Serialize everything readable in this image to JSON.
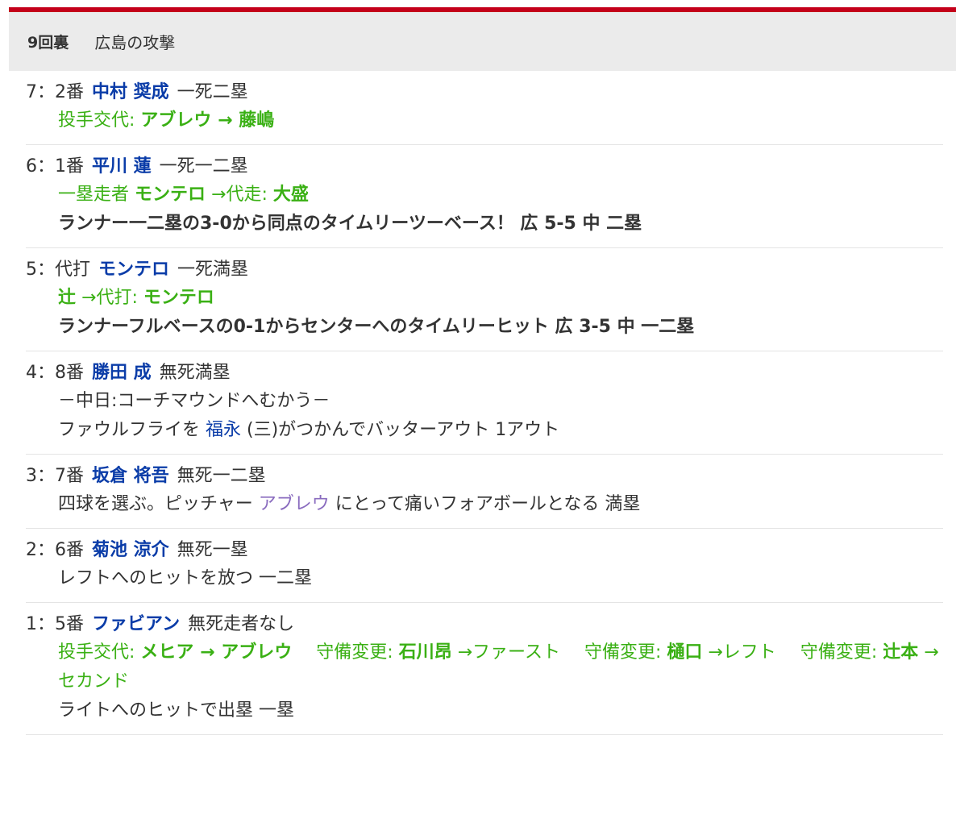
{
  "header": {
    "inning": "9回裏",
    "attack": "広島の攻撃"
  },
  "events": [
    {
      "num": "7：",
      "order": "2番",
      "batter": "中村 奨成",
      "situation": "一死二塁",
      "sub": {
        "label": "投手交代: ",
        "from": "アブレウ",
        "arrow": " → ",
        "to": "藤嶋"
      }
    },
    {
      "num": "6：",
      "order": "1番",
      "batter": "平川 蓮",
      "situation": "一死一二塁",
      "sub": {
        "label": "一塁走者 ",
        "from": "モンテロ",
        "arrow": " →代走: ",
        "to": "大盛"
      },
      "result": "ランナー一二塁の3-0から同点のタイムリーツーベース！ 広 5-5 中 二塁"
    },
    {
      "num": "5：",
      "order": "代打",
      "batter": "モンテロ",
      "situation": "一死満塁",
      "sub": {
        "label": "",
        "from": "辻",
        "arrow": " →代打: ",
        "to": "モンテロ"
      },
      "result": "ランナーフルベースの0-1からセンターへのタイムリーヒット 広 3-5 中 一二塁"
    },
    {
      "num": "4：",
      "order": "8番",
      "batter": "勝田 成",
      "situation": "無死満塁",
      "line1": "－中日:コーチマウンドへむかう－",
      "line2_pre": "ファウルフライを ",
      "line2_player": "福永",
      "line2_post": " (三)がつかんでバッターアウト 1アウト"
    },
    {
      "num": "3：",
      "order": "7番",
      "batter": "坂倉 将吾",
      "situation": "無死一二塁",
      "line_pre": "四球を選ぶ。ピッチャー ",
      "line_pitcher": "アブレウ",
      "line_post": " にとって痛いフォアボールとなる 満塁"
    },
    {
      "num": "2：",
      "order": "6番",
      "batter": "菊池 涼介",
      "situation": "無死一塁",
      "line": "レフトへのヒットを放つ 一二塁"
    },
    {
      "num": "1：",
      "order": "5番",
      "batter": "ファビアン",
      "situation": "無死走者なし",
      "changes": [
        {
          "label": "投手交代: ",
          "from": "メヒア",
          "arrow": " → ",
          "to": "アブレウ"
        },
        {
          "label": "守備変更: ",
          "player": "石川昂",
          "pos": " →ファースト"
        },
        {
          "label": "守備変更: ",
          "player": "樋口",
          "pos": " →レフト"
        },
        {
          "label": "守備変更: ",
          "player": "辻本",
          "pos": " →セカンド"
        }
      ],
      "line": "ライトへのヒットで出塁 一塁"
    }
  ]
}
